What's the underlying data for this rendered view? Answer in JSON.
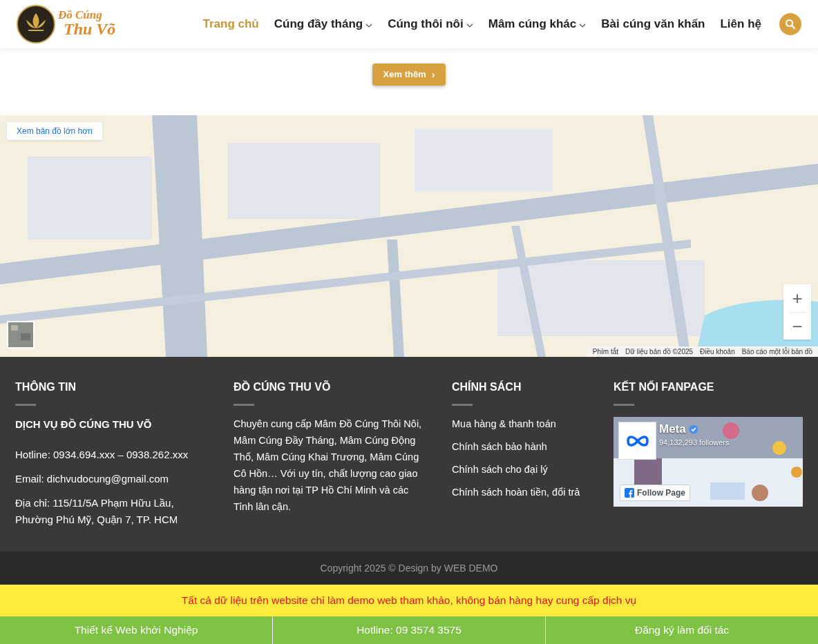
{
  "header": {
    "logo": {
      "line_1": "Đồ Cúng",
      "line_2": "Thu Võ"
    },
    "nav": [
      {
        "label": "Trang chủ",
        "selected": true,
        "dropdown": false
      },
      {
        "label": "Cúng đầy tháng",
        "selected": false,
        "dropdown": true
      },
      {
        "label": "Cúng thôi nôi",
        "selected": false,
        "dropdown": true
      },
      {
        "label": "Mâm cúng khác",
        "selected": false,
        "dropdown": true
      },
      {
        "label": "Bài cúng văn khấn",
        "selected": false,
        "dropdown": false
      },
      {
        "label": "Liên hệ",
        "selected": false,
        "dropdown": false
      }
    ]
  },
  "more_button": {
    "label": "Xem thêm",
    "arrow": "›"
  },
  "map": {
    "larger_map_link": "Xem bản đồ lớn hơn",
    "zoom_in": "+",
    "zoom_out": "−",
    "attribution": [
      "Phím tắt",
      "Dữ liệu bản đồ ©2025",
      "Điều khoản",
      "Báo cáo một lỗi bản đồ"
    ]
  },
  "footer": {
    "columns": [
      {
        "kind": "info",
        "title": "THÔNG TIN",
        "subtitle": "DỊCH VỤ ĐỒ CÚNG THU VÕ",
        "lines": [
          "Hotline: 0934.694.xxx – 0938.262.xxx",
          "Email: dichvudocung@gmail.com",
          "Địa chỉ: 115/11/5A Phạm Hữu Lầu, Phường Phú Mỹ, Quận 7, TP. HCM"
        ]
      },
      {
        "kind": "text",
        "title": "ĐỒ CÚNG THU VÕ",
        "text": "Chuyên cung cấp Mâm Đồ Cúng Thôi Nôi, Mâm Cúng Đầy Tháng, Mâm Cúng Động Thổ, Mâm Cúng Khai Trương, Mâm Cúng Cô Hồn… Với uy tín, chất lượng cao giao hàng tận nơi tại TP Hồ Chí Minh và các Tỉnh lân cận."
      },
      {
        "kind": "links",
        "title": "CHÍNH SÁCH",
        "links": [
          "Mua hàng & thanh toán",
          "Chính sách bảo hành",
          "Chính sách cho đại lý",
          "Chính sách hoàn tiền, đổi trả"
        ]
      },
      {
        "kind": "fanpage",
        "title": "KẾT NỐI FANPAGE",
        "page_name": "Meta",
        "followers": "94,132,293 followers",
        "follow_button": "Follow Page"
      }
    ],
    "copyright": "Copyright 2025 © Design by WEB DEMO"
  },
  "notice": "Tất cả dữ liệu trên website chỉ làm demo web tham khảo, không bán hàng hay cung cấp dịch vụ",
  "bottom_bar": [
    "Thiết kế Web khởi Nghiệp",
    "Hotline: 09 3574 3575",
    "Đăng ký làm đối tác"
  ]
}
